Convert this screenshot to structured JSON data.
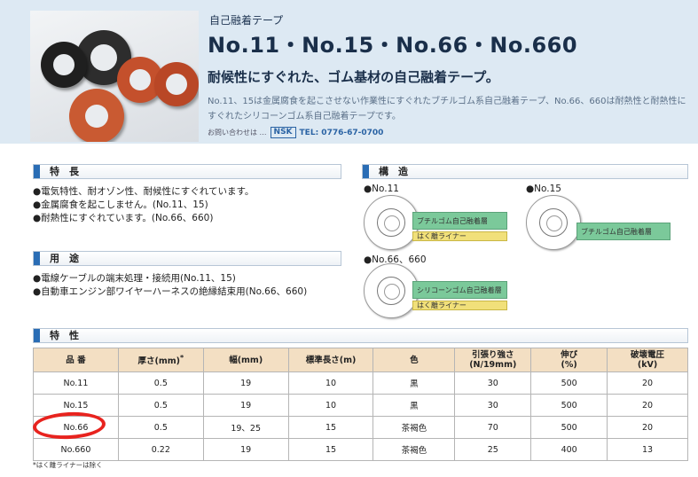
{
  "header": {
    "subtitle": "自己融着テープ",
    "title": "No.11・No.15・No.66・No.660",
    "tagline": "耐候性にすぐれた、ゴム基材の自己融着テープ。",
    "description": "No.11、15は金属腐食を起こさせない作業性にすぐれたブチルゴム系自己融着テープ、No.66、660は耐熱性と耐熱性にすぐれたシリコーンゴム系自己融着テープです。",
    "contact_prefix": "お問い合わせは …",
    "contact_company": "NSK",
    "contact_tel": "TEL: 0776-67-0700",
    "photo_icon": "tape-rolls-photo"
  },
  "features": {
    "heading": "特　長",
    "items": [
      "●電気特性、耐オゾン性、耐候性にすぐれています。",
      "●金属腐食を起こしません。(No.11、15)",
      "●耐熱性にすぐれています。(No.66、660)"
    ]
  },
  "uses": {
    "heading": "用　途",
    "items": [
      "●電線ケーブルの端末処理・接続用(No.11、15)",
      "●自動車エンジン部ワイヤーハーネスの絶縁結束用(No.66、660)"
    ]
  },
  "structure": {
    "heading": "構　造",
    "no11": {
      "label": "●No.11",
      "layer1": "ブチルゴム自己融着層",
      "layer2": "はく離ライナー"
    },
    "no15": {
      "label": "●No.15",
      "layer1": "ブチルゴム自己融着層"
    },
    "no66": {
      "label": "●No.66、660",
      "layer1": "シリコーンゴム自己融着層",
      "layer2": "はく離ライナー"
    }
  },
  "properties": {
    "heading": "特　性",
    "columns": [
      "品 番",
      "厚さ(mm)",
      "幅(mm)",
      "標準長さ(m)",
      "色",
      "引張り強さ",
      "伸び",
      "破壊電圧"
    ],
    "columns_sub": [
      "",
      "*",
      "",
      "",
      "",
      "(N/19mm)",
      "(%)",
      "(kV)"
    ],
    "rows": [
      [
        "No.11",
        "0.5",
        "19",
        "10",
        "黒",
        "30",
        "500",
        "20"
      ],
      [
        "No.15",
        "0.5",
        "19",
        "10",
        "黒",
        "30",
        "500",
        "20"
      ],
      [
        "No.66",
        "0.5",
        "19、25",
        "15",
        "茶褐色",
        "70",
        "500",
        "20"
      ],
      [
        "No.660",
        "0.22",
        "19",
        "15",
        "茶褐色",
        "25",
        "400",
        "13"
      ]
    ],
    "footnote": "*はく離ライナーは除く",
    "highlighted_row": "No.66"
  },
  "colors": {
    "header_bg": "#dde9f3",
    "accent_blue": "#2a6db5",
    "table_header": "#f3dfc3",
    "layer_green": "#7bc99a",
    "layer_yellow": "#f1e07a",
    "highlight_red": "#e8231e"
  }
}
